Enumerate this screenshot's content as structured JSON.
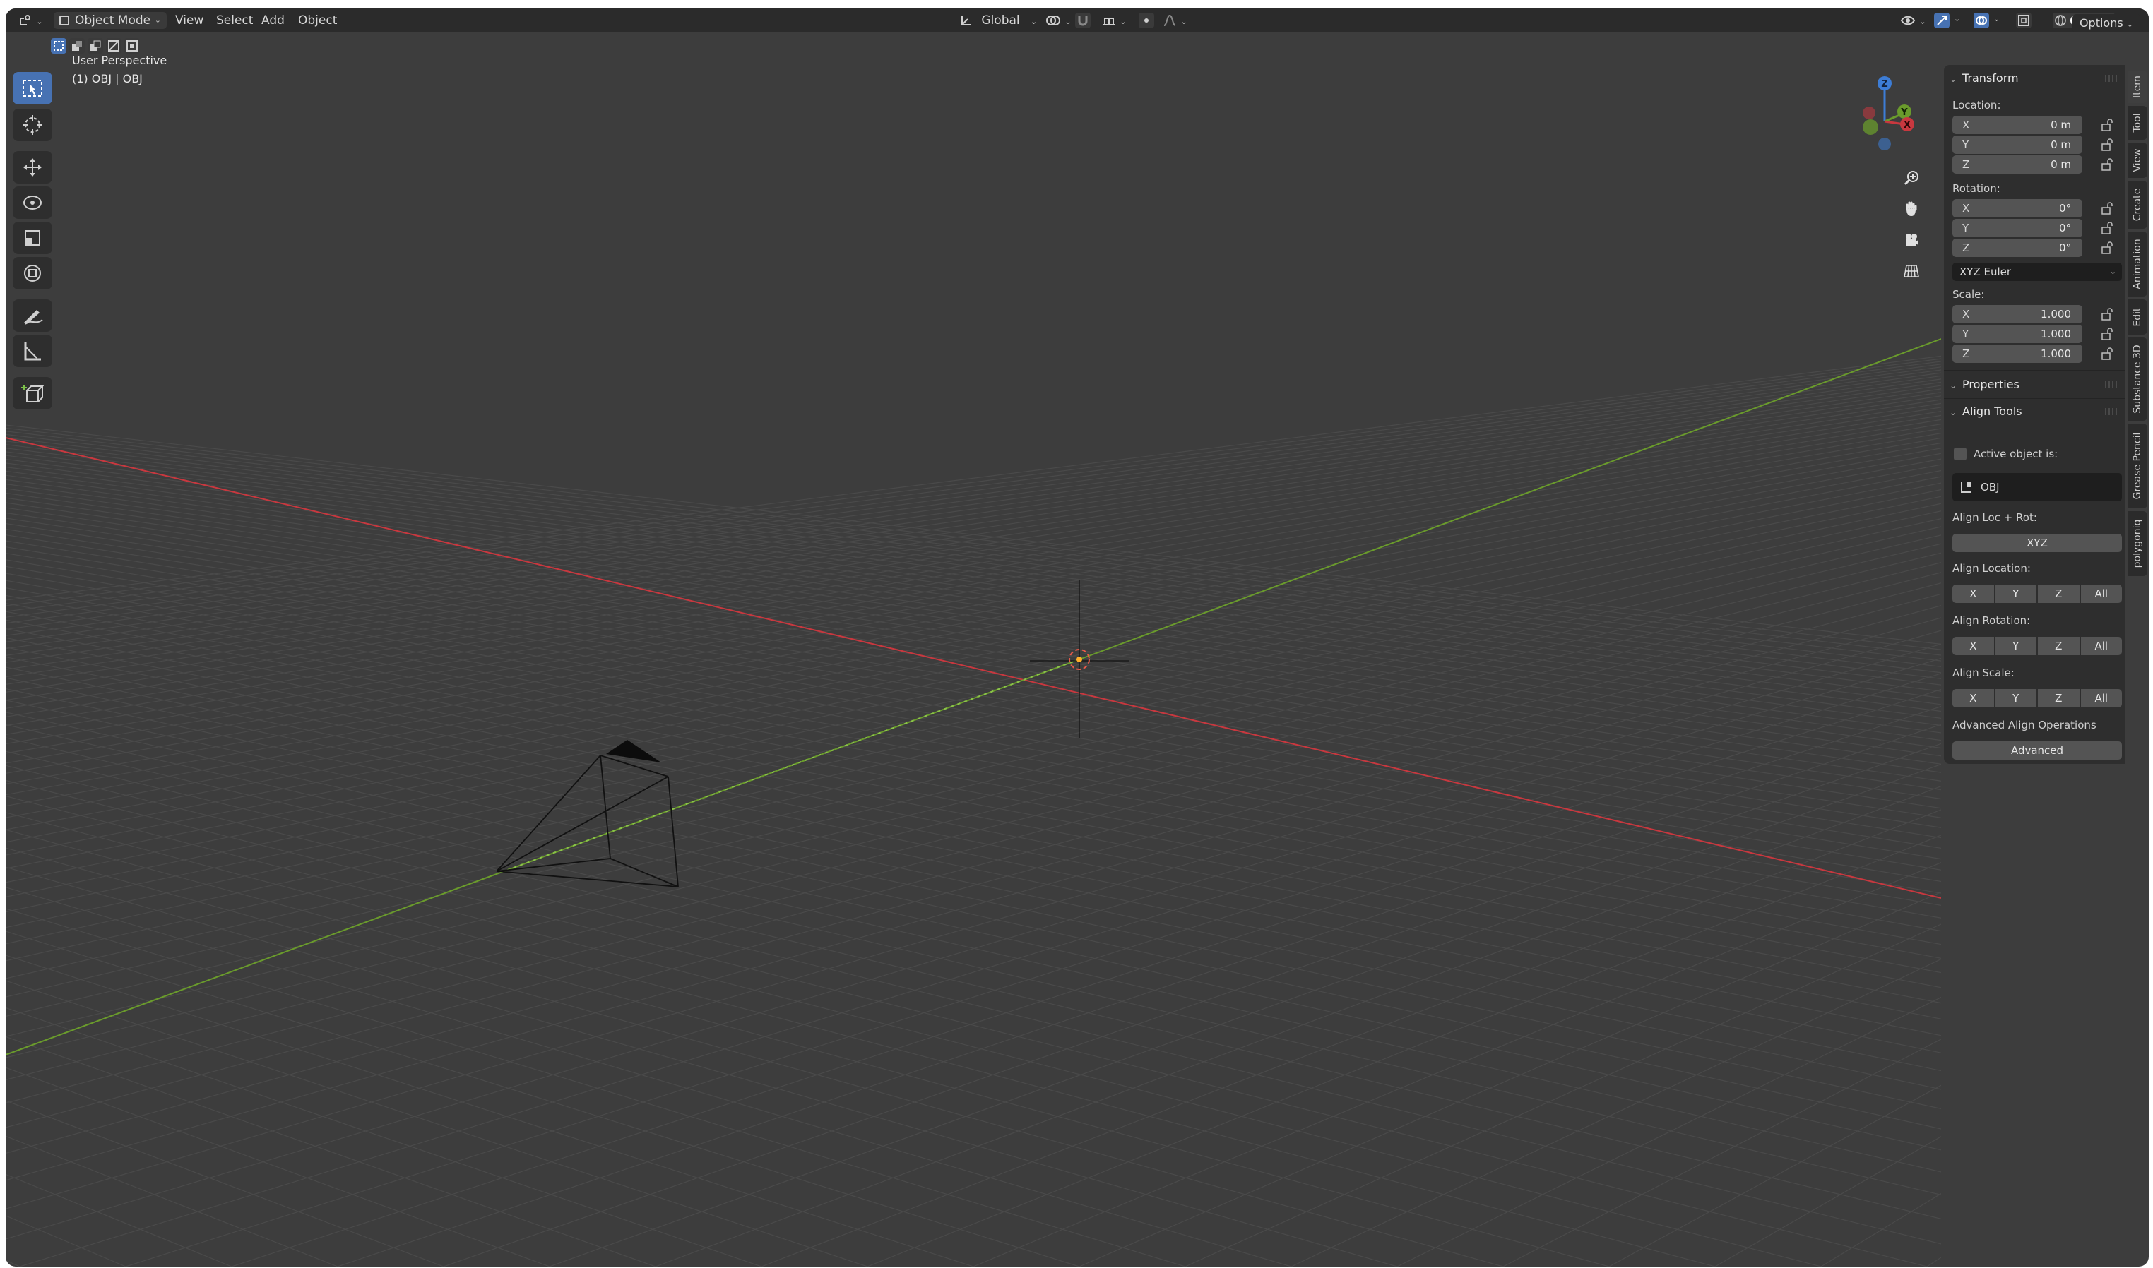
{
  "header": {
    "mode_label": "Object Mode",
    "menus": [
      "View",
      "Select",
      "Add",
      "Object"
    ],
    "orientation_label": "Global",
    "options_label": "Options"
  },
  "viewport": {
    "title": "User Perspective",
    "subtitle": "(1) OBJ | OBJ",
    "gizmo_axes": [
      "X",
      "Y",
      "Z"
    ],
    "colors": {
      "x_axis": "#c8383f",
      "y_axis": "#6a9b2c",
      "z_axis": "#3d7dd6",
      "background": "#3d3d3d"
    }
  },
  "toolbar": {
    "tools": [
      "select-box-icon",
      "cursor-icon",
      "move-icon",
      "rotate-icon",
      "scale-icon",
      "transform-icon",
      "annotate-icon",
      "measure-icon",
      "add-cube-icon"
    ]
  },
  "panel": {
    "transform": {
      "title": "Transform",
      "location_label": "Location:",
      "location": [
        {
          "axis": "X",
          "value": "0 m"
        },
        {
          "axis": "Y",
          "value": "0 m"
        },
        {
          "axis": "Z",
          "value": "0 m"
        }
      ],
      "rotation_label": "Rotation:",
      "rotation": [
        {
          "axis": "X",
          "value": "0°"
        },
        {
          "axis": "Y",
          "value": "0°"
        },
        {
          "axis": "Z",
          "value": "0°"
        }
      ],
      "rotation_mode": "XYZ Euler",
      "scale_label": "Scale:",
      "scale": [
        {
          "axis": "X",
          "value": "1.000"
        },
        {
          "axis": "Y",
          "value": "1.000"
        },
        {
          "axis": "Z",
          "value": "1.000"
        }
      ]
    },
    "properties_title": "Properties",
    "align_tools": {
      "title": "Align Tools",
      "active_object_label": "Active object is:",
      "active_object": "OBJ",
      "align_locrot_label": "Align Loc + Rot:",
      "align_locrot_button": "XYZ",
      "align_location_label": "Align Location:",
      "align_rotation_label": "Align Rotation:",
      "align_scale_label": "Align Scale:",
      "axis_buttons": [
        "X",
        "Y",
        "Z",
        "All"
      ],
      "advanced_label": "Advanced Align Operations",
      "advanced_button": "Advanced"
    }
  },
  "tabs": [
    "Item",
    "Tool",
    "View",
    "Create",
    "Animation",
    "Edit",
    "Substance 3D",
    "Grease Pencil",
    "polygoniq"
  ]
}
